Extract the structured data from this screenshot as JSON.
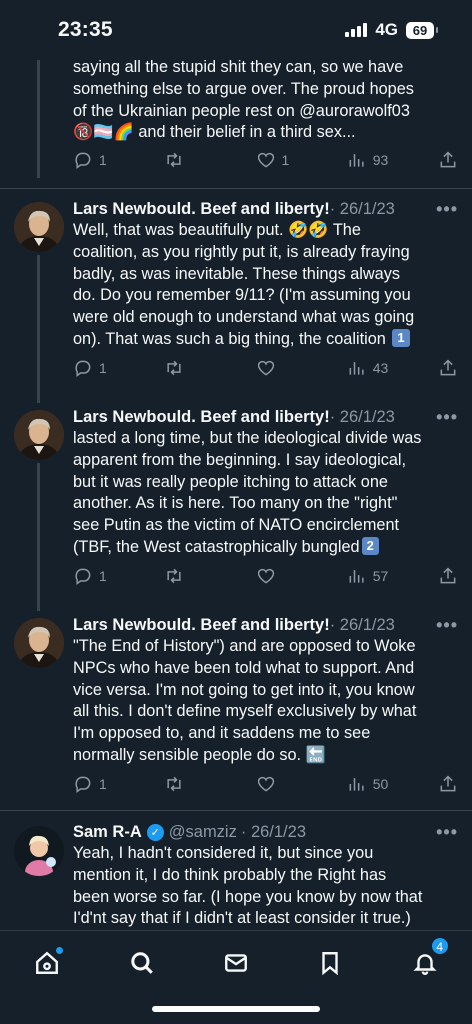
{
  "status_bar": {
    "time": "23:35",
    "network": "4G",
    "battery": "69"
  },
  "tweets": [
    {
      "name": "",
      "date": "",
      "lines": [
        "saying all the stupid shit they can, so we have",
        "something else to argue over. The proud hopes",
        "of the Ukrainian people rest on @aurorawolf03",
        "🔞🏳️‍⚧️🌈 and their belief in a third sex..."
      ],
      "replies": "1",
      "retweets": "",
      "likes": "1",
      "views": "93"
    },
    {
      "name": "Lars Newbould. Beef and liberty!",
      "date": "· 26/1/23",
      "lines": [
        "Well, that was beautifully put. 🤣🤣 The",
        "coalition, as you rightly put it, is already fraying",
        "badly, as was inevitable. These things always",
        "do. Do you remember 9/11? (I'm assuming you",
        "were old enough to understand what was going",
        "on). That was such a big thing, the coalition"
      ],
      "badge": "1",
      "replies": "1",
      "retweets": "",
      "likes": "",
      "views": "43"
    },
    {
      "name": "Lars Newbould. Beef and liberty!",
      "date": "· 26/1/23",
      "lines": [
        "lasted a long time, but the ideological divide was",
        "apparent from the beginning. I say ideological,",
        "but it was really people itching to attack one",
        "another. As it is here. Too many on the \"right\"",
        "see Putin as the victim of NATO encirclement",
        "(TBF, the West catastrophically bungled"
      ],
      "badge": "2",
      "replies": "1",
      "retweets": "",
      "likes": "",
      "views": "57"
    },
    {
      "name": "Lars Newbould. Beef and liberty!",
      "date": "· 26/1/23",
      "lines": [
        "\"The End of History\") and are opposed to Woke",
        "NPCs who have been told what to support. And",
        "vice versa. I'm not going to get into it, you know",
        "all this. I don't define myself exclusively by what",
        "I'm opposed to, and it saddens me to see",
        "normally sensible people do so. 🔚"
      ],
      "replies": "1",
      "retweets": "",
      "likes": "",
      "views": "50"
    },
    {
      "name": "Sam R-A",
      "handle": "@samziz",
      "date": "· 26/1/23",
      "lines": [
        "Yeah, I hadn't considered it, but since you",
        "mention it, I do think probably the Right has",
        "been worse so far. (I hope you know by now that",
        "I'd'nt say that if I didn't at least consider it true.)"
      ]
    }
  ],
  "tabbar": {
    "notifications_count": "4"
  },
  "colors": {
    "background": "#15202b",
    "accent": "#1d9bf0",
    "muted": "#8b98a5"
  },
  "icons": [
    "home-icon",
    "search-icon",
    "mail-icon",
    "bookmark-icon",
    "bell-icon",
    "reply-icon",
    "retweet-icon",
    "like-icon",
    "views-icon",
    "share-icon",
    "more-icon",
    "verified-icon"
  ]
}
